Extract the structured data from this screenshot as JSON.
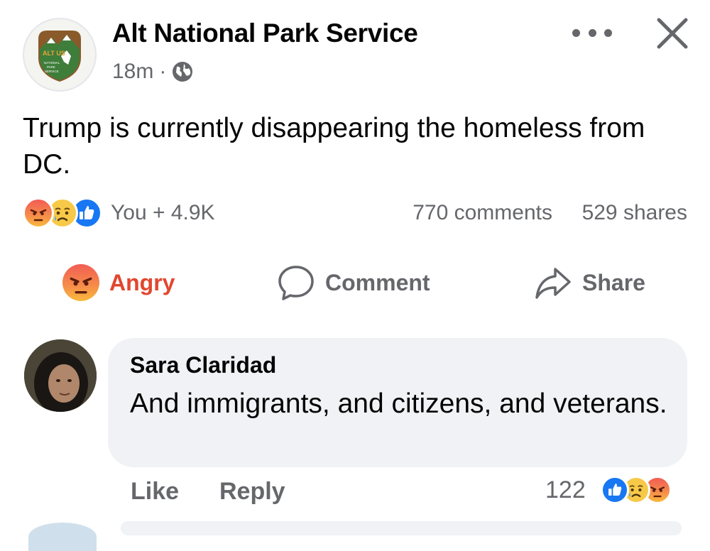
{
  "post": {
    "page_name": "Alt National Park Service",
    "timestamp": "18m",
    "separator": "·",
    "privacy_icon": "globe-icon",
    "logo_text": "ALT US",
    "logo_subtext": "NATIONAL PARK SERVICE",
    "text": "Trump is currently disappearing the homeless from DC."
  },
  "reactions": {
    "icons": [
      "angry-reaction-icon",
      "sad-reaction-icon",
      "like-reaction-icon"
    ],
    "reactors": "You + 4.9K",
    "comments": "770 comments",
    "shares": "529 shares"
  },
  "actions": {
    "react_label": "Angry",
    "comment_label": "Comment",
    "share_label": "Share"
  },
  "comment": {
    "author": "Sara Claridad",
    "text": "And immigrants, and citizens, and veterans.",
    "like_label": "Like",
    "reply_label": "Reply",
    "reaction_count": "122",
    "reaction_icons": [
      "like-reaction-icon",
      "sad-reaction-icon",
      "angry-reaction-icon"
    ]
  },
  "colors": {
    "meta_gray": "#65676b",
    "angry_red": "#e1472f",
    "like_blue": "#1877f2",
    "bubble_bg": "#f0f2f5"
  }
}
